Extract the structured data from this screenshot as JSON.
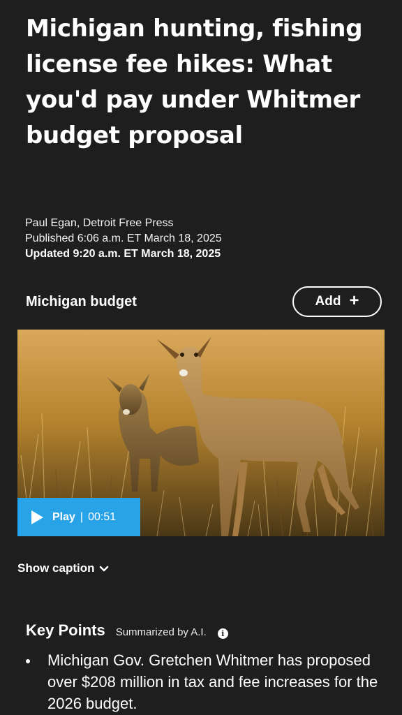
{
  "article": {
    "headline": "Michigan hunting, fishing license fee hikes: What you'd pay under Whitmer budget proposal",
    "author": "Paul Egan, Detroit Free Press",
    "published": "Published 6:06 a.m. ET March 18, 2025",
    "updated": "Updated 9:20 a.m. ET March 18, 2025"
  },
  "topic": {
    "label": "Michigan budget",
    "add_label": "Add",
    "add_icon": "plus-icon"
  },
  "media": {
    "play_label": "Play",
    "separator": "|",
    "duration": "00:51",
    "play_icon": "play-icon"
  },
  "caption": {
    "toggle_label": "Show caption",
    "toggle_icon": "chevron-down-icon"
  },
  "key_points": {
    "title": "Key Points",
    "subtitle": "Summarized by A.I.",
    "info_icon": "info-icon",
    "items": [
      "Michigan Gov. Gretchen Whitmer has proposed over $208 million in tax and fee increases for the 2026 budget."
    ]
  },
  "colors": {
    "background": "#1e1e1e",
    "text": "#ffffff",
    "play_accent": "#29a3e8"
  }
}
